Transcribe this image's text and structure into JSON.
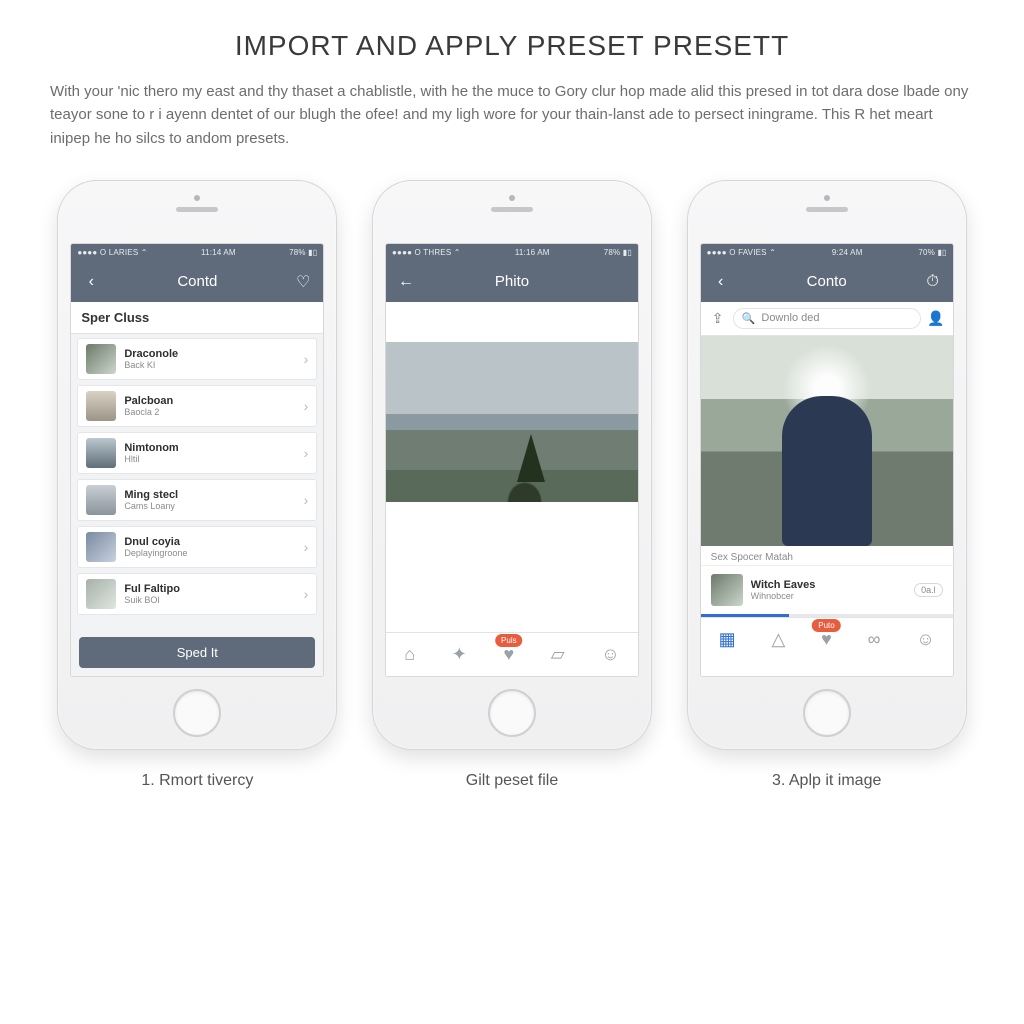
{
  "header": {
    "title": "IMPORT AND APPLY PRESET PRESETT",
    "intro": "With your 'nic thero my east and thy thaset a chablistle, with he the muce to Gory clur hop made alid this presed in tot dara dose lbade ony teayor sone to r i ayenn dentet of our blugh the ofee! and my ligh wore for your thain-lanst ade to persect iningrame.  This R het meart inipep he ho silcs to andom presets."
  },
  "phones": [
    {
      "status": {
        "left": "●●●●  O LARIES  ⌃",
        "time": "11:14 AM",
        "right": "78%  ▮▯"
      },
      "nav": {
        "back": "‹",
        "title": "Contd",
        "right": "♡"
      },
      "section_header": "Sper Cluss",
      "button_label": "Sped It",
      "items": [
        {
          "title": "Draconole",
          "sub": "Back KI"
        },
        {
          "title": "Palcboan",
          "sub": "Baocla 2"
        },
        {
          "title": "Nimtonom",
          "sub": "Hltil"
        },
        {
          "title": "Ming stecl",
          "sub": "Cams Loany"
        },
        {
          "title": "Dnul coyia",
          "sub": "Deplayingroone"
        },
        {
          "title": "Ful Faltipo",
          "sub": "Suik BOl"
        }
      ]
    },
    {
      "status": {
        "left": "●●●●  O THRES  ⌃",
        "time": "11:16 AM",
        "right": "78%  ▮▯"
      },
      "nav": {
        "back": "←",
        "title": "Phito",
        "right": ""
      },
      "tabs": {
        "badge": "Puls"
      }
    },
    {
      "status": {
        "left": "●●●●  O FAVIES  ⌃",
        "time": "9:24 AM",
        "right": "70%  ▮▯"
      },
      "nav": {
        "back": "‹",
        "title": "Conto",
        "right": "⏱"
      },
      "search": {
        "upload_icon": "⇪",
        "placeholder": "Downlo ded",
        "user_icon": "👤"
      },
      "subtext": "Sex Spocer Matah",
      "card": {
        "title": "Witch Eaves",
        "sub": "Wihnobcer",
        "pill": "0a.l"
      },
      "tabs": {
        "badge": "Puto"
      }
    }
  ],
  "captions": [
    "1. Rmort tivercy",
    "Gilt peset file",
    "3. Aplp it image"
  ]
}
